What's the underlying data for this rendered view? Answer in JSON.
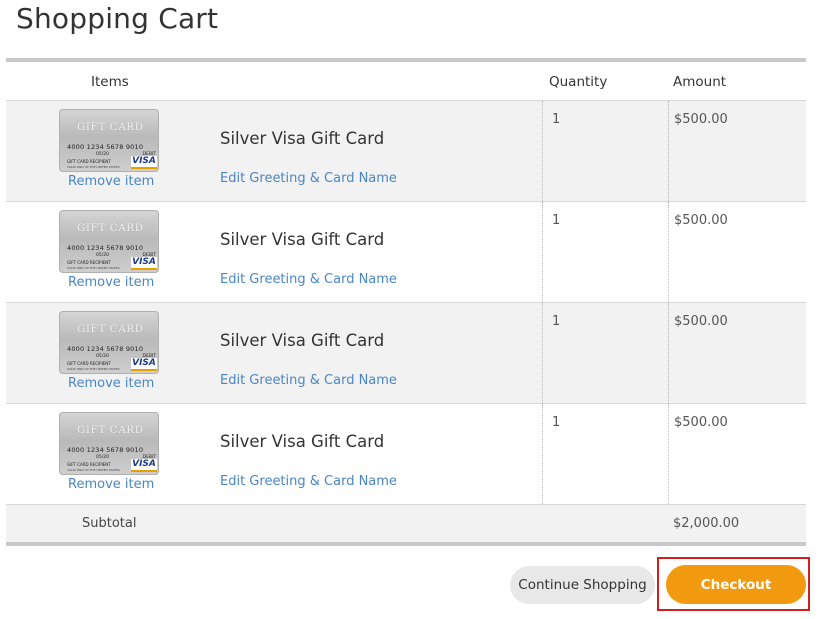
{
  "page": {
    "title": "Shopping Cart"
  },
  "table": {
    "headers": {
      "items": "Items",
      "quantity": "Quantity",
      "amount": "Amount"
    },
    "rows": [
      {
        "name": "Silver Visa Gift Card",
        "edit_label": "Edit Greeting & Card Name",
        "remove_label": "Remove item",
        "quantity": "1",
        "amount": "$500.00"
      },
      {
        "name": "Silver Visa Gift Card",
        "edit_label": "Edit Greeting & Card Name",
        "remove_label": "Remove item",
        "quantity": "1",
        "amount": "$500.00"
      },
      {
        "name": "Silver Visa Gift Card",
        "edit_label": "Edit Greeting & Card Name",
        "remove_label": "Remove item",
        "quantity": "1",
        "amount": "$500.00"
      },
      {
        "name": "Silver Visa Gift Card",
        "edit_label": "Edit Greeting & Card Name",
        "remove_label": "Remove item",
        "quantity": "1",
        "amount": "$500.00"
      }
    ],
    "subtotal": {
      "label": "Subtotal",
      "value": "$2,000.00"
    }
  },
  "card_image": {
    "brand_text": "GIFT CARD",
    "number": "4000 1234 5678 9010",
    "expiry": "05/20",
    "type": "DEBIT",
    "recipient": "GIFT CARD RECIPIENT",
    "validity": "VALID ONLY IN THE UNITED STATES",
    "network": "VISA"
  },
  "actions": {
    "continue_label": "Continue Shopping",
    "checkout_label": "Checkout"
  },
  "colors": {
    "accent_orange": "#f29a0f",
    "link_blue": "#4a86c5",
    "highlight_red": "#d51d1d"
  }
}
